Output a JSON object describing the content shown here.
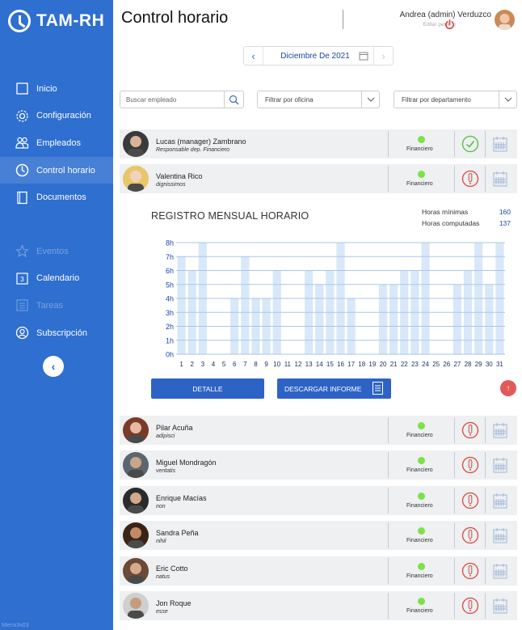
{
  "app": {
    "logo_text": "TAM-RH",
    "version": "Ntenx3v03"
  },
  "sidebar": {
    "items": [
      {
        "label": "Inicio",
        "icon": "square-icon",
        "active": false,
        "disabled": false
      },
      {
        "label": "Configuración",
        "icon": "gear-icon",
        "active": false,
        "disabled": false
      },
      {
        "label": "Empleados",
        "icon": "people-icon",
        "active": false,
        "disabled": false
      },
      {
        "label": "Control horario",
        "icon": "clock-icon",
        "active": true,
        "disabled": false
      },
      {
        "label": "Documentos",
        "icon": "document-icon",
        "active": false,
        "disabled": false
      },
      {
        "label": "Eventos",
        "icon": "star-icon",
        "active": false,
        "disabled": true
      },
      {
        "label": "Calendario",
        "icon": "calendar-3-icon",
        "active": false,
        "disabled": false
      },
      {
        "label": "Tareas",
        "icon": "tasks-icon",
        "active": false,
        "disabled": true
      },
      {
        "label": "Subscripción",
        "icon": "user-circle-icon",
        "active": false,
        "disabled": false
      }
    ],
    "collapse_glyph": "‹"
  },
  "header": {
    "title": "Control horario",
    "user_name": "Andrea (admin) Verduzco",
    "edit_profile": "Editar perfil",
    "separator": "|"
  },
  "date_picker": {
    "label": "Diciembre De 2021",
    "prev": "‹",
    "next": "›"
  },
  "filters": {
    "search_placeholder": "Buscar empleado",
    "office": "Filtrar por oficina",
    "department": "Filtrar por departamento"
  },
  "employees_top": [
    {
      "name": "Lucas (manager) Zambrano",
      "role": "Responsable dep. Financiero",
      "office": "Financiero",
      "state": "ok",
      "avatar_bg": "#3a3a3a",
      "avatar_skin": "#d9b49a"
    },
    {
      "name": "Valentina Rico",
      "role": "dignissimos",
      "office": "Financiero",
      "state": "alert",
      "avatar_bg": "#e8c76a",
      "avatar_skin": "#f2d2bd"
    }
  ],
  "chart_panel": {
    "title": "REGISTRO MENSUAL HORARIO",
    "stats": [
      {
        "label": "Horas mínimas",
        "value": "160"
      },
      {
        "label": "Horas computadas",
        "value": "137"
      }
    ],
    "detail_button": "DETALLE",
    "download_button": "DESCARGAR INFORME",
    "scroll_top_glyph": "↑"
  },
  "chart_data": {
    "type": "bar",
    "categories": [
      "1",
      "2",
      "3",
      "4",
      "5",
      "6",
      "7",
      "8",
      "9",
      "10",
      "11",
      "12",
      "13",
      "14",
      "15",
      "16",
      "17",
      "18",
      "19",
      "20",
      "21",
      "22",
      "23",
      "24",
      "25",
      "26",
      "27",
      "28",
      "29",
      "30",
      "31"
    ],
    "values": [
      7,
      6,
      8,
      0,
      0,
      4,
      7,
      4,
      4,
      6,
      0,
      0,
      6,
      5,
      6,
      8,
      4,
      0,
      0,
      5,
      5,
      6,
      6,
      8,
      0,
      0,
      5,
      6,
      8,
      5,
      8
    ],
    "yticks": [
      "0h",
      "1h",
      "2h",
      "3h",
      "4h",
      "5h",
      "6h",
      "7h",
      "8h"
    ],
    "ylim": [
      0,
      8
    ],
    "grid": true,
    "bar_color": "#d8e8f8",
    "grid_color": "#a9c7ea",
    "tick_color": "#1a47a8"
  },
  "employees_bottom": [
    {
      "name": "Pilar Acuña",
      "role": "adipisci",
      "office": "Financiero",
      "state": "alert",
      "avatar_bg": "#7a3b2a",
      "avatar_skin": "#e6b9a0"
    },
    {
      "name": "Miguel Mondragón",
      "role": "veritatis",
      "office": "Financiero",
      "state": "alert",
      "avatar_bg": "#5d6670",
      "avatar_skin": "#c9a58a"
    },
    {
      "name": "Enrique Macías",
      "role": "non",
      "office": "Financiero",
      "state": "alert",
      "avatar_bg": "#2b2b2b",
      "avatar_skin": "#d1a98b"
    },
    {
      "name": "Sandra Peña",
      "role": "nihil",
      "office": "Financiero",
      "state": "alert",
      "avatar_bg": "#3a2418",
      "avatar_skin": "#c08a68"
    },
    {
      "name": "Eric Cotto",
      "role": "natus",
      "office": "Financiero",
      "state": "alert",
      "avatar_bg": "#6b4a36",
      "avatar_skin": "#d6ab8c"
    },
    {
      "name": "Jon Roque",
      "role": "esse",
      "office": "Financiero",
      "state": "alert",
      "avatar_bg": "#cfcfcf",
      "avatar_skin": "#c79c7d"
    }
  ],
  "colors": {
    "sidebar": "#2e6fd0",
    "accent": "#1a47a8",
    "button": "#2e63c6",
    "alert": "#d9473f",
    "ok": "#4bbf3a",
    "row_bg": "#eef0f1"
  }
}
